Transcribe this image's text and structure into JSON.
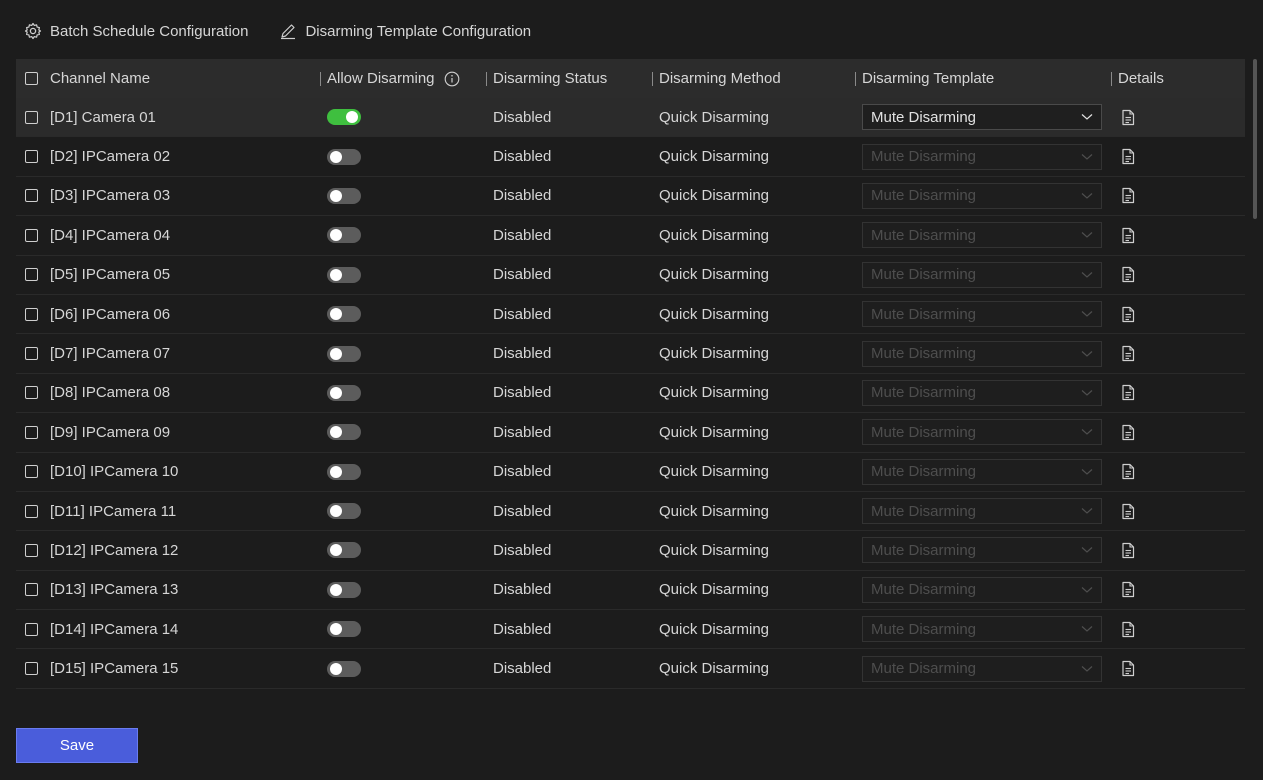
{
  "toolbar": {
    "batch_label": "Batch Schedule Configuration",
    "template_label": "Disarming Template Configuration"
  },
  "table": {
    "headers": {
      "channel_name": "Channel Name",
      "allow_disarming": "Allow Disarming",
      "disarming_status": "Disarming Status",
      "disarming_method": "Disarming Method",
      "disarming_template": "Disarming Template",
      "details": "Details"
    },
    "rows": [
      {
        "name": "[D1] Camera 01",
        "allow": true,
        "status": "Disabled",
        "method": "Quick Disarming",
        "template": "Mute Disarming"
      },
      {
        "name": "[D2] IPCamera 02",
        "allow": false,
        "status": "Disabled",
        "method": "Quick Disarming",
        "template": "Mute Disarming"
      },
      {
        "name": "[D3] IPCamera 03",
        "allow": false,
        "status": "Disabled",
        "method": "Quick Disarming",
        "template": "Mute Disarming"
      },
      {
        "name": "[D4] IPCamera 04",
        "allow": false,
        "status": "Disabled",
        "method": "Quick Disarming",
        "template": "Mute Disarming"
      },
      {
        "name": "[D5] IPCamera 05",
        "allow": false,
        "status": "Disabled",
        "method": "Quick Disarming",
        "template": "Mute Disarming"
      },
      {
        "name": "[D6] IPCamera 06",
        "allow": false,
        "status": "Disabled",
        "method": "Quick Disarming",
        "template": "Mute Disarming"
      },
      {
        "name": "[D7] IPCamera 07",
        "allow": false,
        "status": "Disabled",
        "method": "Quick Disarming",
        "template": "Mute Disarming"
      },
      {
        "name": "[D8] IPCamera 08",
        "allow": false,
        "status": "Disabled",
        "method": "Quick Disarming",
        "template": "Mute Disarming"
      },
      {
        "name": "[D9] IPCamera 09",
        "allow": false,
        "status": "Disabled",
        "method": "Quick Disarming",
        "template": "Mute Disarming"
      },
      {
        "name": "[D10] IPCamera 10",
        "allow": false,
        "status": "Disabled",
        "method": "Quick Disarming",
        "template": "Mute Disarming"
      },
      {
        "name": "[D11] IPCamera 11",
        "allow": false,
        "status": "Disabled",
        "method": "Quick Disarming",
        "template": "Mute Disarming"
      },
      {
        "name": "[D12] IPCamera 12",
        "allow": false,
        "status": "Disabled",
        "method": "Quick Disarming",
        "template": "Mute Disarming"
      },
      {
        "name": "[D13] IPCamera 13",
        "allow": false,
        "status": "Disabled",
        "method": "Quick Disarming",
        "template": "Mute Disarming"
      },
      {
        "name": "[D14] IPCamera 14",
        "allow": false,
        "status": "Disabled",
        "method": "Quick Disarming",
        "template": "Mute Disarming"
      },
      {
        "name": "[D15] IPCamera 15",
        "allow": false,
        "status": "Disabled",
        "method": "Quick Disarming",
        "template": "Mute Disarming"
      }
    ]
  },
  "footer": {
    "save_label": "Save"
  },
  "colors": {
    "background": "#1c1c1c",
    "toggle_on": "#3fbf3f",
    "toggle_off": "#5c5c5c",
    "primary_button": "#4a5ddb"
  }
}
